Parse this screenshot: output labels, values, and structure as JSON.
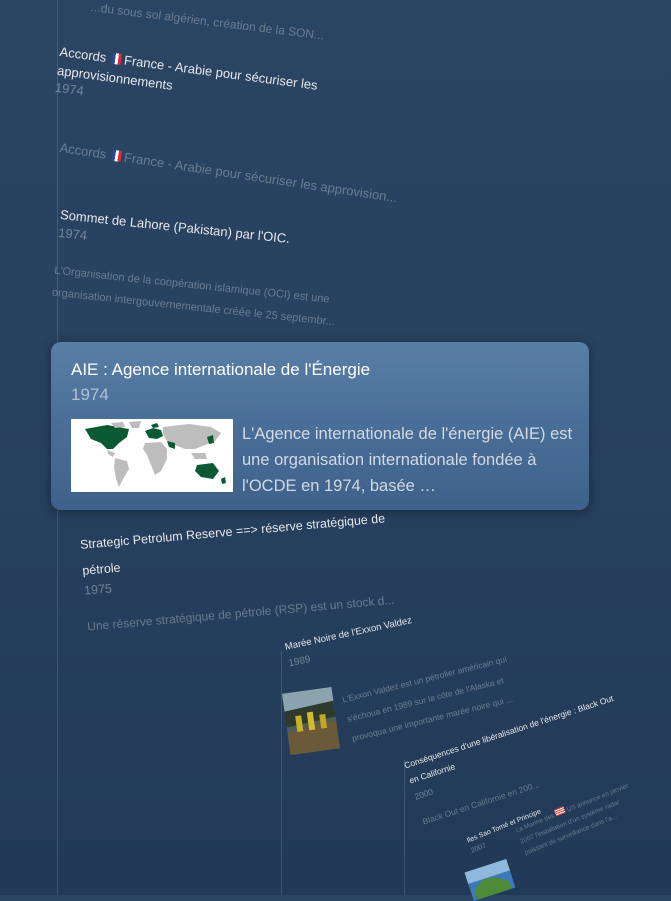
{
  "timeline": {
    "top_fragment": "...du sous sol algérien, création de la SON...",
    "entries": [
      {
        "title_a": "Accords",
        "title_b": "France - Arabie pour sécuriser les approvisionnements",
        "year": "1974"
      },
      {
        "title_a": "Accords",
        "title_b": "France - Arabie pour sécuriser les approvision..."
      },
      {
        "title": "Sommet de Lahore (Pakistan) par l'OIC.",
        "year": "1974",
        "desc_1": "L'Organisation de la coopération islamique (OCI) est une",
        "desc_2": "organisation intergouvernementale créée le 25 septembr..."
      },
      {
        "title_1": "Strategic Petrolum Reserve ==> réserve stratégique de",
        "title_2": "pétrole",
        "year": "1975",
        "desc": "Une réserve stratégique de pétrole (RSP) est un stock d..."
      },
      {
        "title": "Marée Noire de l'Exxon Valdez",
        "year": "1989",
        "desc_1": "L'Exxon Valdez est un pétrolier américain qui",
        "desc_2": "s'échoua en 1989 sur la côte de l'Alaska et",
        "desc_3": "provoqua une importante marée noire qui ..."
      },
      {
        "title_1": "Conséquences d'une libéralisation de l'énergie : Black Out",
        "title_2": "en Californie",
        "year": "2000",
        "desc": "Black Out en Californie en 200..."
      },
      {
        "title": "Iles Sao Tomé et Principe",
        "year": "2007",
        "desc_1": "La Marine des",
        "desc_1b": "US annonce en janvier",
        "desc_2": "2007 l'installation d'un système radar",
        "desc_3": "puissant de surveillance dans l'a..."
      }
    ]
  },
  "selected_card": {
    "title": "AIE : Agence internationale de l'Énergie",
    "year": "1974",
    "description": "L'Agence internationale de l'énergie (AIE) est une organisation internationale fondée à l'OCDE en 1974, basée …",
    "image_icon": "world-map-members-icon"
  },
  "colors": {
    "background": "#28415f",
    "card": "#4a6f98",
    "map_member": "#0c5a34",
    "map_other": "#bdbdbd"
  }
}
